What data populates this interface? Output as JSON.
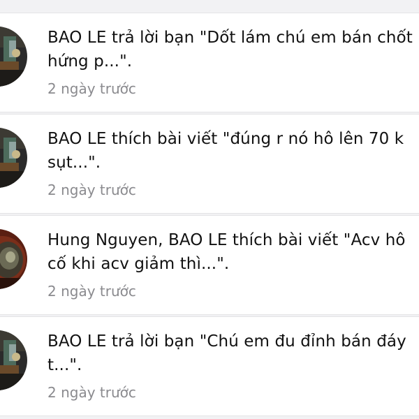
{
  "notifications": [
    {
      "line1": "BAO LE trả lời bạn \"Dốt lám chú em bán chốt",
      "line2": "hứng p...\".",
      "time": "2 ngày trước",
      "avatar": "avatar-icon"
    },
    {
      "line1": "BAO LE thích bài viết \"đúng r nó hô lên 70 k",
      "line2": "sụt...\".",
      "time": "2 ngày trước",
      "avatar": "avatar-icon"
    },
    {
      "line1": "Hung Nguyen, BAO LE thích bài viết \"Acv hô",
      "line2": "cố khi acv giảm thì...\".",
      "time": "2 ngày trước",
      "avatar": "avatar-icon"
    },
    {
      "line1": "BAO LE trả lời bạn \"Chú em đu đỉnh bán đáy",
      "line2": "t...\".",
      "time": "2 ngày trước",
      "avatar": "avatar-icon"
    }
  ],
  "colors": {
    "background": "#f2f2f4",
    "row": "#ffffff",
    "text": "#111111",
    "secondary": "#8a8a8e",
    "divider": "#e4e4e6"
  }
}
